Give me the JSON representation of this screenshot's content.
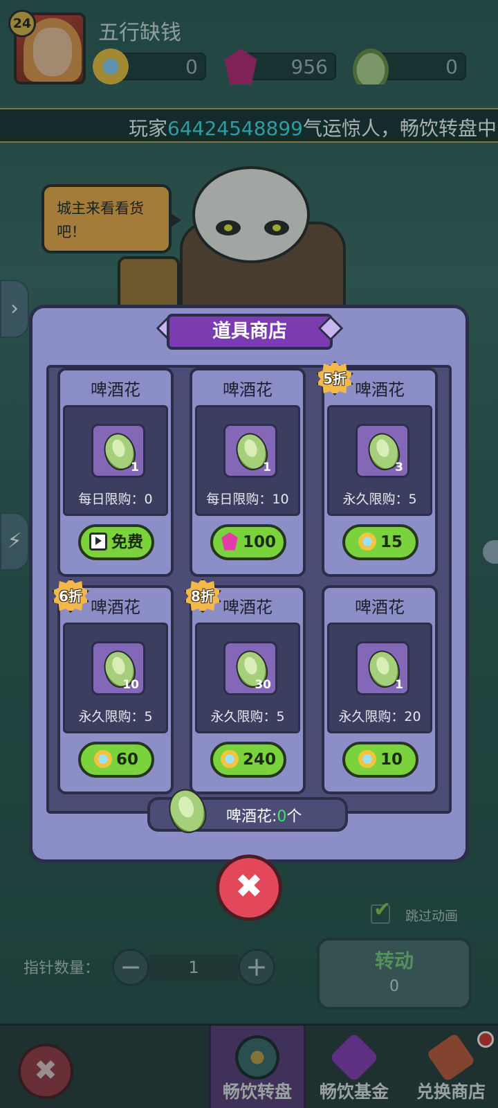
{
  "player": {
    "level": "24",
    "name": "五行缺钱"
  },
  "currencies": [
    {
      "name": "coin",
      "value": "0",
      "icon": "coin-icon"
    },
    {
      "name": "gem",
      "value": "956",
      "icon": "gem-icon"
    },
    {
      "name": "hop",
      "value": "0",
      "icon": "hop-icon"
    }
  ],
  "marquee": {
    "prefix": "玩家",
    "player_id": "64424548899",
    "suffix": "气运惊人，畅饮转盘中"
  },
  "npc": {
    "speech": "城主来看看货吧！"
  },
  "side_tabs": [
    "›",
    "⚡"
  ],
  "controls": {
    "skip_label": "跳过动画",
    "skip_checked": true,
    "pointer_label": "指针数量：",
    "pointer_value": "1",
    "spin_label": "转动",
    "spin_cost": "0"
  },
  "shop": {
    "title": "道具商店",
    "items": [
      {
        "name": "啤酒花",
        "qty": "1",
        "limit": "每日限购：0",
        "price": "免费",
        "price_icon": "tv-icon",
        "discount": ""
      },
      {
        "name": "啤酒花",
        "qty": "1",
        "limit": "每日限购：10",
        "price": "100",
        "price_icon": "gem-icon",
        "discount": ""
      },
      {
        "name": "啤酒花",
        "qty": "3",
        "limit": "永久限购：5",
        "price": "15",
        "price_icon": "coin-icon",
        "discount": "5折"
      },
      {
        "name": "啤酒花",
        "qty": "10",
        "limit": "永久限购：5",
        "price": "60",
        "price_icon": "coin-icon",
        "discount": "6折"
      },
      {
        "name": "啤酒花",
        "qty": "30",
        "limit": "永久限购：5",
        "price": "240",
        "price_icon": "coin-icon",
        "discount": "8折"
      },
      {
        "name": "啤酒花",
        "qty": "1",
        "limit": "永久限购：20",
        "price": "10",
        "price_icon": "coin-icon",
        "discount": ""
      }
    ],
    "owned_label": "啤酒花:",
    "owned_count": "0",
    "owned_unit": "个",
    "close_symbol": "✖"
  },
  "bottom_nav": {
    "close_symbol": "✖",
    "tabs": [
      {
        "label": "畅饮转盘",
        "active": true
      },
      {
        "label": "畅饮基金",
        "active": false
      },
      {
        "label": "兑换商店",
        "active": false,
        "badge": true
      }
    ]
  }
}
